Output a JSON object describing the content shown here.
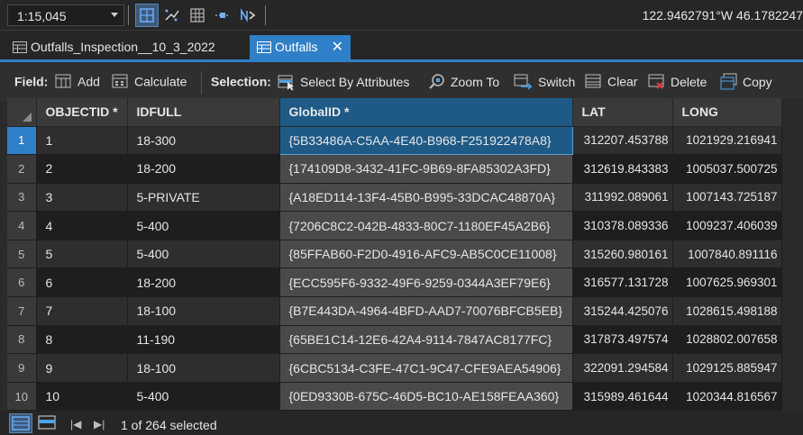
{
  "topbar": {
    "scale_value": "1:15,045",
    "coordinates": "122.9462791°W 46.1782247"
  },
  "tabs": [
    {
      "label": "Outfalls_Inspection__10_3_2022",
      "active": false
    },
    {
      "label": "Outfalls",
      "active": true,
      "close": "✕"
    }
  ],
  "toolbar": {
    "field_label": "Field:",
    "add": "Add",
    "calculate": "Calculate",
    "selection_label": "Selection:",
    "select_by_attributes": "Select By Attributes",
    "zoom_to": "Zoom To",
    "switch": "Switch",
    "clear": "Clear",
    "delete": "Delete",
    "copy": "Copy"
  },
  "table": {
    "columns": [
      "OBJECTID *",
      "IDFULL",
      "GlobalID *",
      "LAT",
      "LONG"
    ],
    "rows": [
      {
        "n": "1",
        "objectid": "1",
        "idfull": "18-300",
        "globalid": "{5B33486A-C5AA-4E40-B968-F251922478A8}",
        "lat": "312207.453788",
        "long": "1021929.216941"
      },
      {
        "n": "2",
        "objectid": "2",
        "idfull": "18-200",
        "globalid": "{174109D8-3432-41FC-9B69-8FA85302A3FD}",
        "lat": "312619.843383",
        "long": "1005037.500725"
      },
      {
        "n": "3",
        "objectid": "3",
        "idfull": "5-PRIVATE",
        "globalid": "{A18ED114-13F4-45B0-B995-33DCAC48870A}",
        "lat": "311992.089061",
        "long": "1007143.725187"
      },
      {
        "n": "4",
        "objectid": "4",
        "idfull": "5-400",
        "globalid": "{7206C8C2-042B-4833-80C7-1180EF45A2B6}",
        "lat": "310378.089336",
        "long": "1009237.406039"
      },
      {
        "n": "5",
        "objectid": "5",
        "idfull": "5-400",
        "globalid": "{85FFAB60-F2D0-4916-AFC9-AB5C0CE11008}",
        "lat": "315260.980161",
        "long": "1007840.891116"
      },
      {
        "n": "6",
        "objectid": "6",
        "idfull": "18-200",
        "globalid": "{ECC595F6-9332-49F6-9259-0344A3EF79E6}",
        "lat": "316577.131728",
        "long": "1007625.969301"
      },
      {
        "n": "7",
        "objectid": "7",
        "idfull": "18-100",
        "globalid": "{B7E443DA-4964-4BFD-AAD7-70076BFCB5EB}",
        "lat": "315244.425076",
        "long": "1028615.498188"
      },
      {
        "n": "8",
        "objectid": "8",
        "idfull": "11-190",
        "globalid": "{65BE1C14-12E6-42A4-9114-7847AC8177FC}",
        "lat": "317873.497574",
        "long": "1028802.007658"
      },
      {
        "n": "9",
        "objectid": "9",
        "idfull": "18-100",
        "globalid": "{6CBC5134-C3FE-47C1-9C47-CFE9AEA54906}",
        "lat": "322091.294584",
        "long": "1029125.885947"
      },
      {
        "n": "10",
        "objectid": "10",
        "idfull": "5-400",
        "globalid": "{0ED9330B-675C-46D5-BC10-AE158FEAA360}",
        "lat": "315989.461644",
        "long": "1020344.816567"
      }
    ]
  },
  "footer": {
    "status": "1 of 264 selected",
    "first_glyph": "|◀",
    "last_glyph": "▶|"
  },
  "colors": {
    "accent": "#2f80c8",
    "selected_header": "#1f5a86",
    "background": "#2b2b2b"
  }
}
